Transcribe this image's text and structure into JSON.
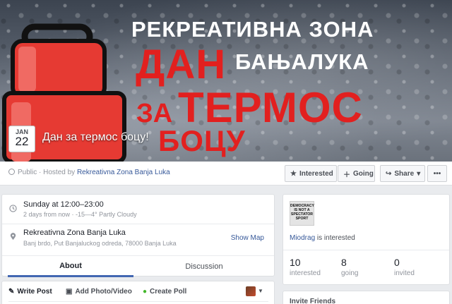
{
  "event": {
    "title": "Дан за термос боцу!",
    "date_month": "JAN",
    "date_day": "22"
  },
  "cover": {
    "line1": "РЕКРЕАТИВНА ЗОНА",
    "line2": "ДАН",
    "line3": "БАЊАЛУКА",
    "line4": "ЗА",
    "line5": "ТЕРМОС",
    "line6": "БОЦУ",
    "accent_color": "#e2201f"
  },
  "infobar": {
    "privacy": "Public",
    "hosted_by_prefix": "· Hosted by",
    "host": "Rekreativna Zona Banja Luka",
    "interested_label": "Interested",
    "going_label": "Going",
    "share_label": "Share"
  },
  "details": {
    "time_main": "Sunday at 12:00–23:00",
    "time_sub": "2 days from now · -15—4° Partly Cloudy",
    "place_main": "Rekreativna Zona Banja Luka",
    "place_sub": "Banj brdo, Put Banjaluckog odreda, 78000 Banja Luka",
    "show_map": "Show Map"
  },
  "tabs": {
    "about": "About",
    "discussion": "Discussion"
  },
  "composer": {
    "write_post": "Write Post",
    "add_photo": "Add Photo/Video",
    "create_poll": "Create Poll"
  },
  "guests": {
    "thumb_text": "DEMOCRACY IS NOT A SPECTATOR SPORT",
    "friend_name": "Miodrag",
    "friend_status": "is interested",
    "stats": [
      {
        "num": "10",
        "label": "interested"
      },
      {
        "num": "8",
        "label": "going"
      },
      {
        "num": "0",
        "label": "invited"
      }
    ]
  },
  "invite": {
    "title": "Invite Friends"
  },
  "colors": {
    "link": "#365899",
    "brand": "#4267b2",
    "background": "#e9ebee"
  }
}
